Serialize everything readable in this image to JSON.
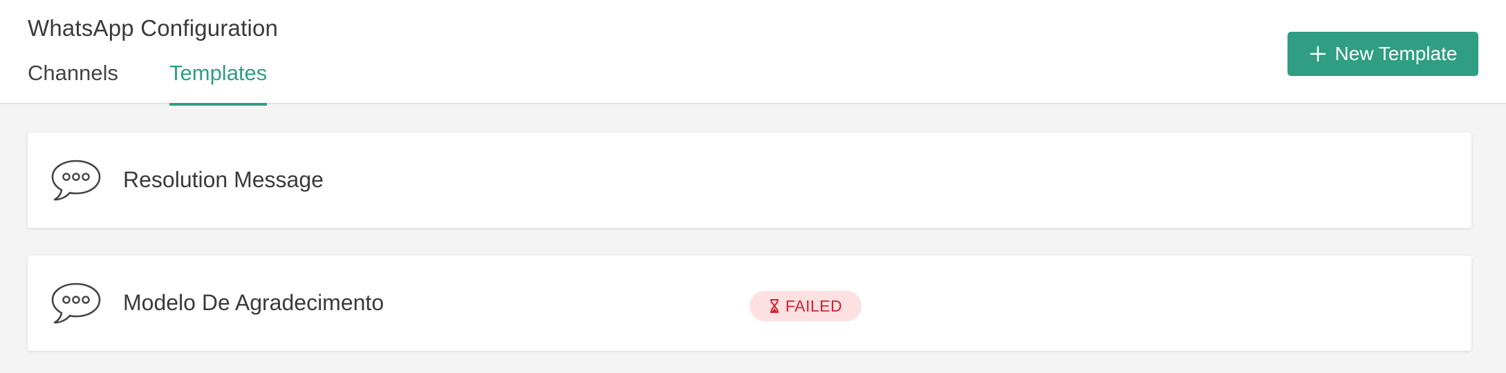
{
  "header": {
    "title": "WhatsApp Configuration",
    "tabs": [
      {
        "label": "Channels",
        "active": false
      },
      {
        "label": "Templates",
        "active": true
      }
    ],
    "new_button_label": "New Template"
  },
  "colors": {
    "accent": "#2f9e82",
    "failed_text": "#d0212e",
    "failed_bg": "#fde0e1"
  },
  "templates": [
    {
      "name": "Resolution Message",
      "icon": "chat-bubble-icon"
    },
    {
      "name": "Modelo De Agradecimento",
      "icon": "chat-bubble-icon",
      "status": "FAILED",
      "status_icon": "hourglass-icon"
    }
  ]
}
